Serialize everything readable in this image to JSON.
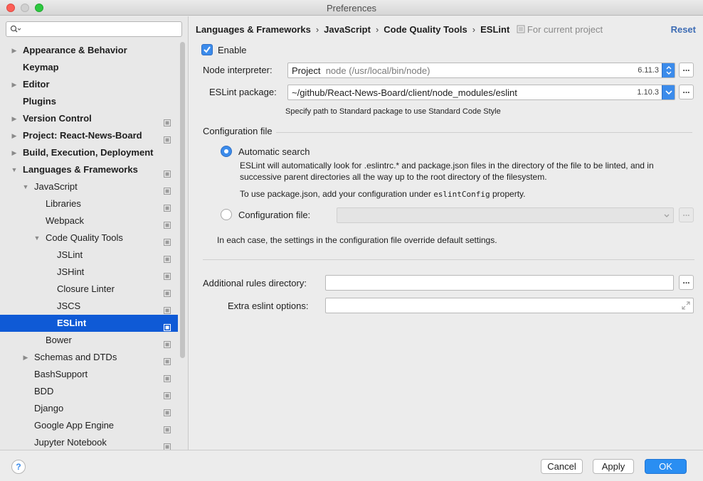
{
  "window": {
    "title": "Preferences"
  },
  "sidebar": {
    "search_placeholder": "",
    "items": [
      {
        "label": "Appearance & Behavior",
        "level": 0,
        "bold": true,
        "arrow": "right",
        "cfg": false
      },
      {
        "label": "Keymap",
        "level": 0,
        "bold": true,
        "arrow": "",
        "cfg": false
      },
      {
        "label": "Editor",
        "level": 0,
        "bold": true,
        "arrow": "right",
        "cfg": false
      },
      {
        "label": "Plugins",
        "level": 0,
        "bold": true,
        "arrow": "",
        "cfg": false
      },
      {
        "label": "Version Control",
        "level": 0,
        "bold": true,
        "arrow": "right",
        "cfg": true
      },
      {
        "label": "Project: React-News-Board",
        "level": 0,
        "bold": true,
        "arrow": "right",
        "cfg": true
      },
      {
        "label": "Build, Execution, Deployment",
        "level": 0,
        "bold": true,
        "arrow": "right",
        "cfg": false
      },
      {
        "label": "Languages & Frameworks",
        "level": 0,
        "bold": true,
        "arrow": "down",
        "cfg": true
      },
      {
        "label": "JavaScript",
        "level": 1,
        "bold": false,
        "arrow": "down",
        "cfg": true
      },
      {
        "label": "Libraries",
        "level": 2,
        "bold": false,
        "arrow": "",
        "cfg": true
      },
      {
        "label": "Webpack",
        "level": 2,
        "bold": false,
        "arrow": "",
        "cfg": true
      },
      {
        "label": "Code Quality Tools",
        "level": 2,
        "bold": false,
        "arrow": "down",
        "cfg": true
      },
      {
        "label": "JSLint",
        "level": 3,
        "bold": false,
        "arrow": "",
        "cfg": true
      },
      {
        "label": "JSHint",
        "level": 3,
        "bold": false,
        "arrow": "",
        "cfg": true
      },
      {
        "label": "Closure Linter",
        "level": 3,
        "bold": false,
        "arrow": "",
        "cfg": true
      },
      {
        "label": "JSCS",
        "level": 3,
        "bold": false,
        "arrow": "",
        "cfg": true
      },
      {
        "label": "ESLint",
        "level": 3,
        "bold": false,
        "arrow": "",
        "cfg": true,
        "selected": true
      },
      {
        "label": "Bower",
        "level": 2,
        "bold": false,
        "arrow": "",
        "cfg": true
      },
      {
        "label": "Schemas and DTDs",
        "level": 1,
        "bold": false,
        "arrow": "right",
        "cfg": true
      },
      {
        "label": "BashSupport",
        "level": 1,
        "bold": false,
        "arrow": "",
        "cfg": true
      },
      {
        "label": "BDD",
        "level": 1,
        "bold": false,
        "arrow": "",
        "cfg": true
      },
      {
        "label": "Django",
        "level": 1,
        "bold": false,
        "arrow": "",
        "cfg": true
      },
      {
        "label": "Google App Engine",
        "level": 1,
        "bold": false,
        "arrow": "",
        "cfg": true
      },
      {
        "label": "Jupyter Notebook",
        "level": 1,
        "bold": false,
        "arrow": "",
        "cfg": true
      }
    ]
  },
  "breadcrumb": {
    "items": [
      "Languages & Frameworks",
      "JavaScript",
      "Code Quality Tools",
      "ESLint"
    ],
    "separator": "›",
    "scope": "For current project",
    "reset": "Reset"
  },
  "form": {
    "enable_label": "Enable",
    "enable_checked": true,
    "node_interpreter_label": "Node interpreter:",
    "node_interpreter_value": "Project",
    "node_interpreter_path": "node (/usr/local/bin/node)",
    "node_version": "6.11.3",
    "eslint_package_label": "ESLint package:",
    "eslint_package_value": "~/github/React-News-Board/client/node_modules/eslint",
    "eslint_version": "1.10.3",
    "standard_hint": "Specify path to Standard package to use Standard Code Style",
    "browse": "...",
    "config_section": "Configuration file",
    "auto_search_label": "Automatic search",
    "auto_search_desc_1": "ESLint will automatically look for .eslintrc.* and package.json files in the directory of the file to be linted, and in",
    "auto_search_desc_2": "successive parent directories all the way up to the root directory of the filesystem.",
    "package_json_prefix": "To use package.json, add your configuration under ",
    "package_json_code": "eslintConfig",
    "package_json_suffix": " property.",
    "config_file_label": "Configuration file:",
    "override_note": "In each case, the settings in the configuration file override default settings.",
    "rules_dir_label": "Additional rules directory:",
    "rules_dir_value": "",
    "extra_options_label": "Extra eslint options:",
    "extra_options_value": ""
  },
  "footer": {
    "help": "?",
    "cancel": "Cancel",
    "apply": "Apply",
    "ok": "OK"
  },
  "colors": {
    "accent": "#3b8beb",
    "selection": "#0f5ad6",
    "link": "#3d6cb4"
  }
}
